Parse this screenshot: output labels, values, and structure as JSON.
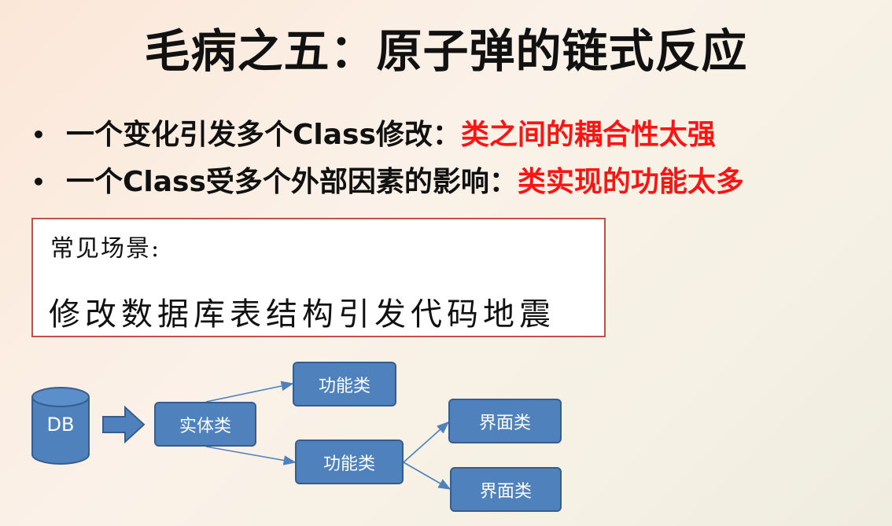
{
  "title": "毛病之五：原子弹的链式反应",
  "bullets": [
    {
      "marker": "•",
      "text": "一个变化引发多个Class修改：",
      "highlight": "类之间的耦合性太强"
    },
    {
      "marker": "•",
      "text": "一个Class受多个外部因素的影响：",
      "highlight": "类实现的功能太多"
    }
  ],
  "scenario": {
    "heading": "常见场景:",
    "text": "修改数据库表结构引发代码地震"
  },
  "diagram": {
    "db_label": "DB",
    "entity": "实体类",
    "function_top": "功能类",
    "function_bottom": "功能类",
    "ui_top": "界面类",
    "ui_bottom": "界面类"
  },
  "colors": {
    "highlight": "#ff1414",
    "box_fill": "#4f81bd",
    "box_border": "#385d8a",
    "scenario_border": "#c0504d"
  }
}
